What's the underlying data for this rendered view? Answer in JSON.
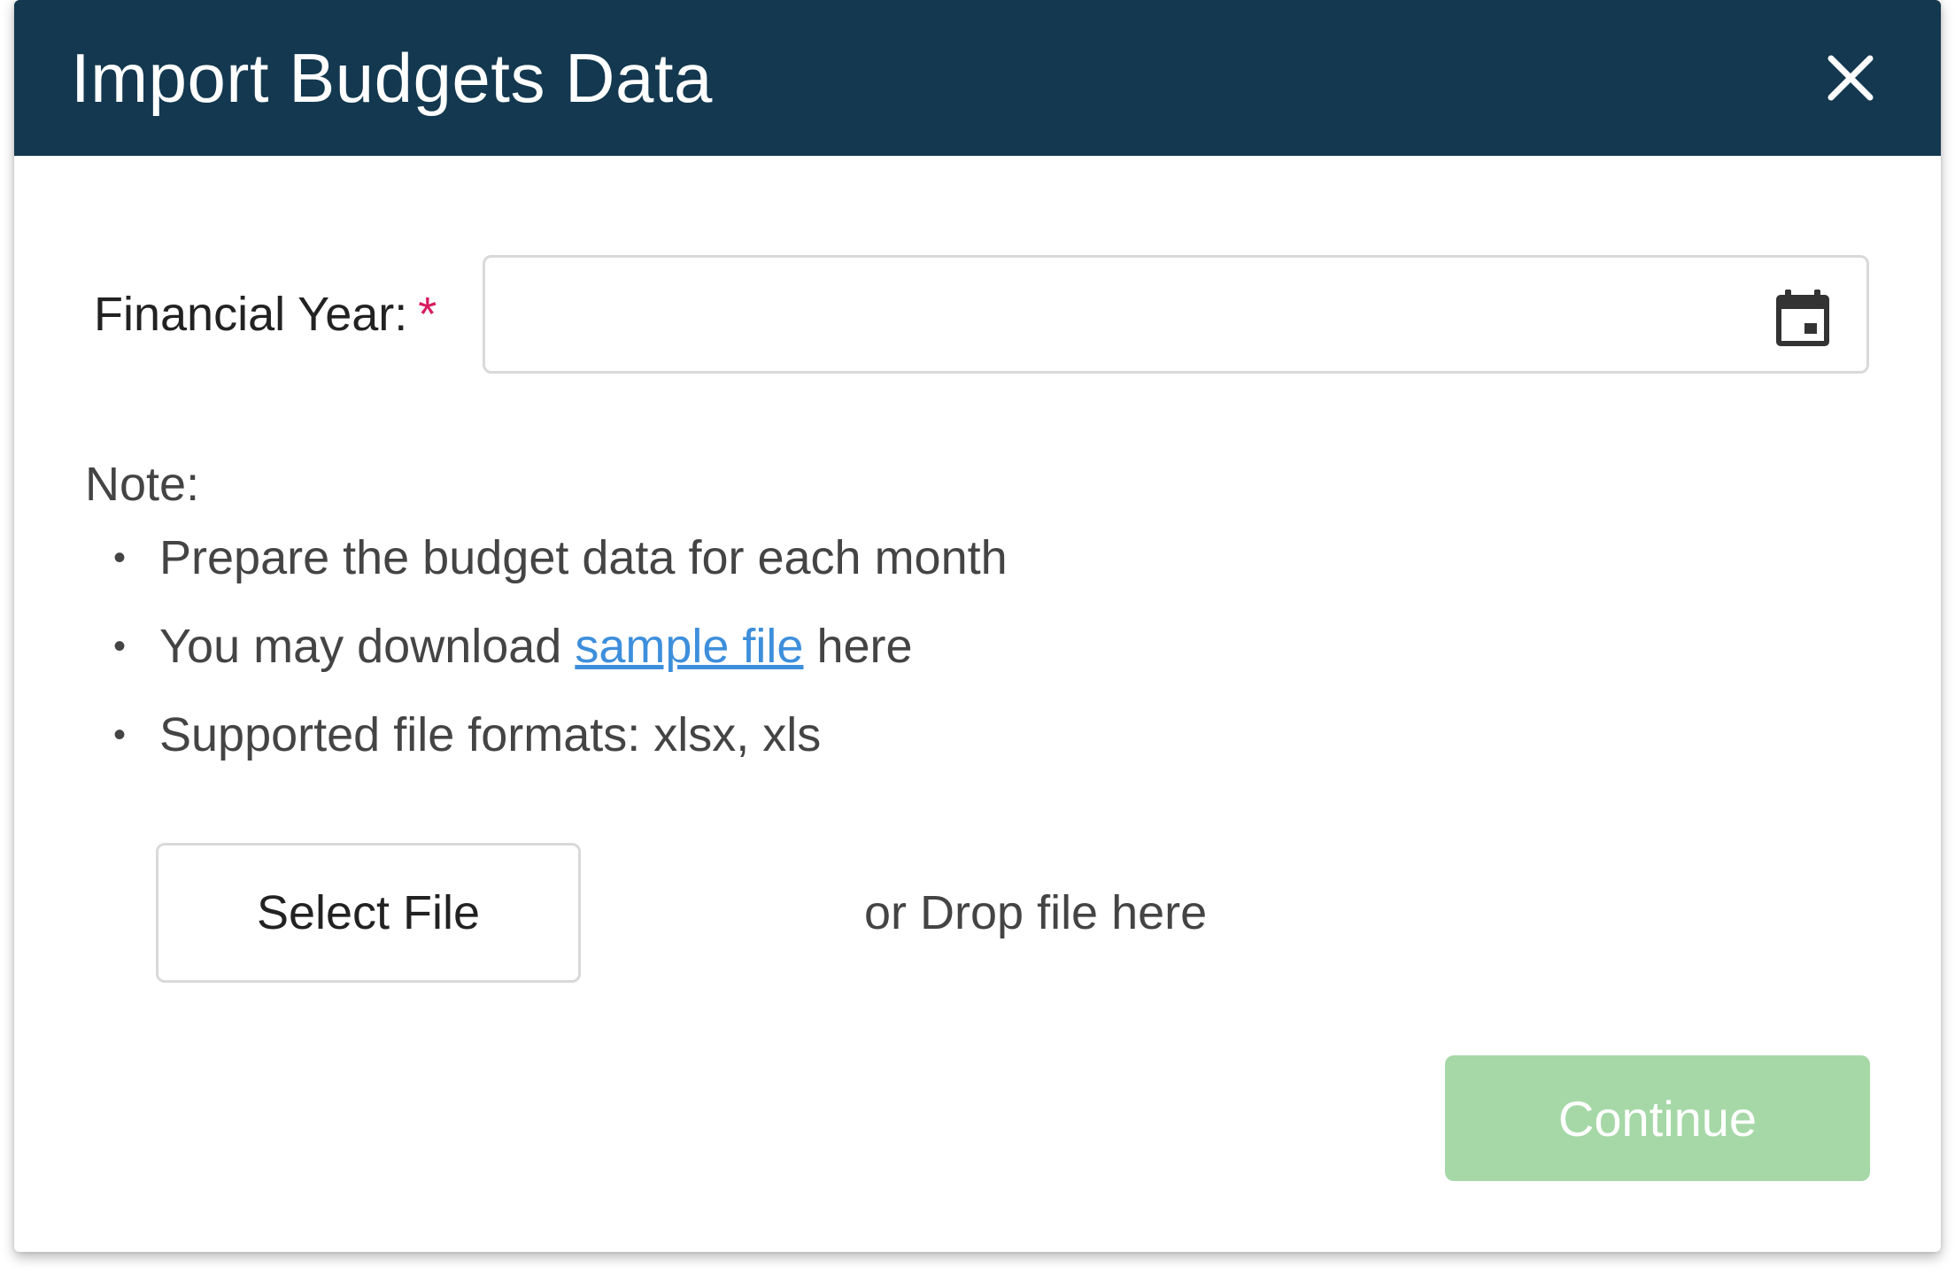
{
  "dialog": {
    "title": "Import Budgets Data",
    "close_icon": "close-icon"
  },
  "form": {
    "financial_year_label": "Financial Year:",
    "required_mark": "*",
    "financial_year_value": "",
    "calendar_icon": "calendar-icon"
  },
  "note": {
    "title": "Note:",
    "items": [
      {
        "text": "Prepare the budget data for each month"
      },
      {
        "prefix": "You may download ",
        "link": "sample file",
        "suffix": " here"
      },
      {
        "text": "Supported file formats: xlsx, xls"
      }
    ],
    "bullet": "•"
  },
  "upload": {
    "select_file_label": "Select File",
    "drop_hint": "or Drop file here"
  },
  "actions": {
    "continue_label": "Continue",
    "continue_enabled": false
  },
  "colors": {
    "header_bg": "#13384f",
    "required": "#d81b60",
    "link": "#3d8fdc",
    "continue_disabled": "#a6d8a7"
  }
}
